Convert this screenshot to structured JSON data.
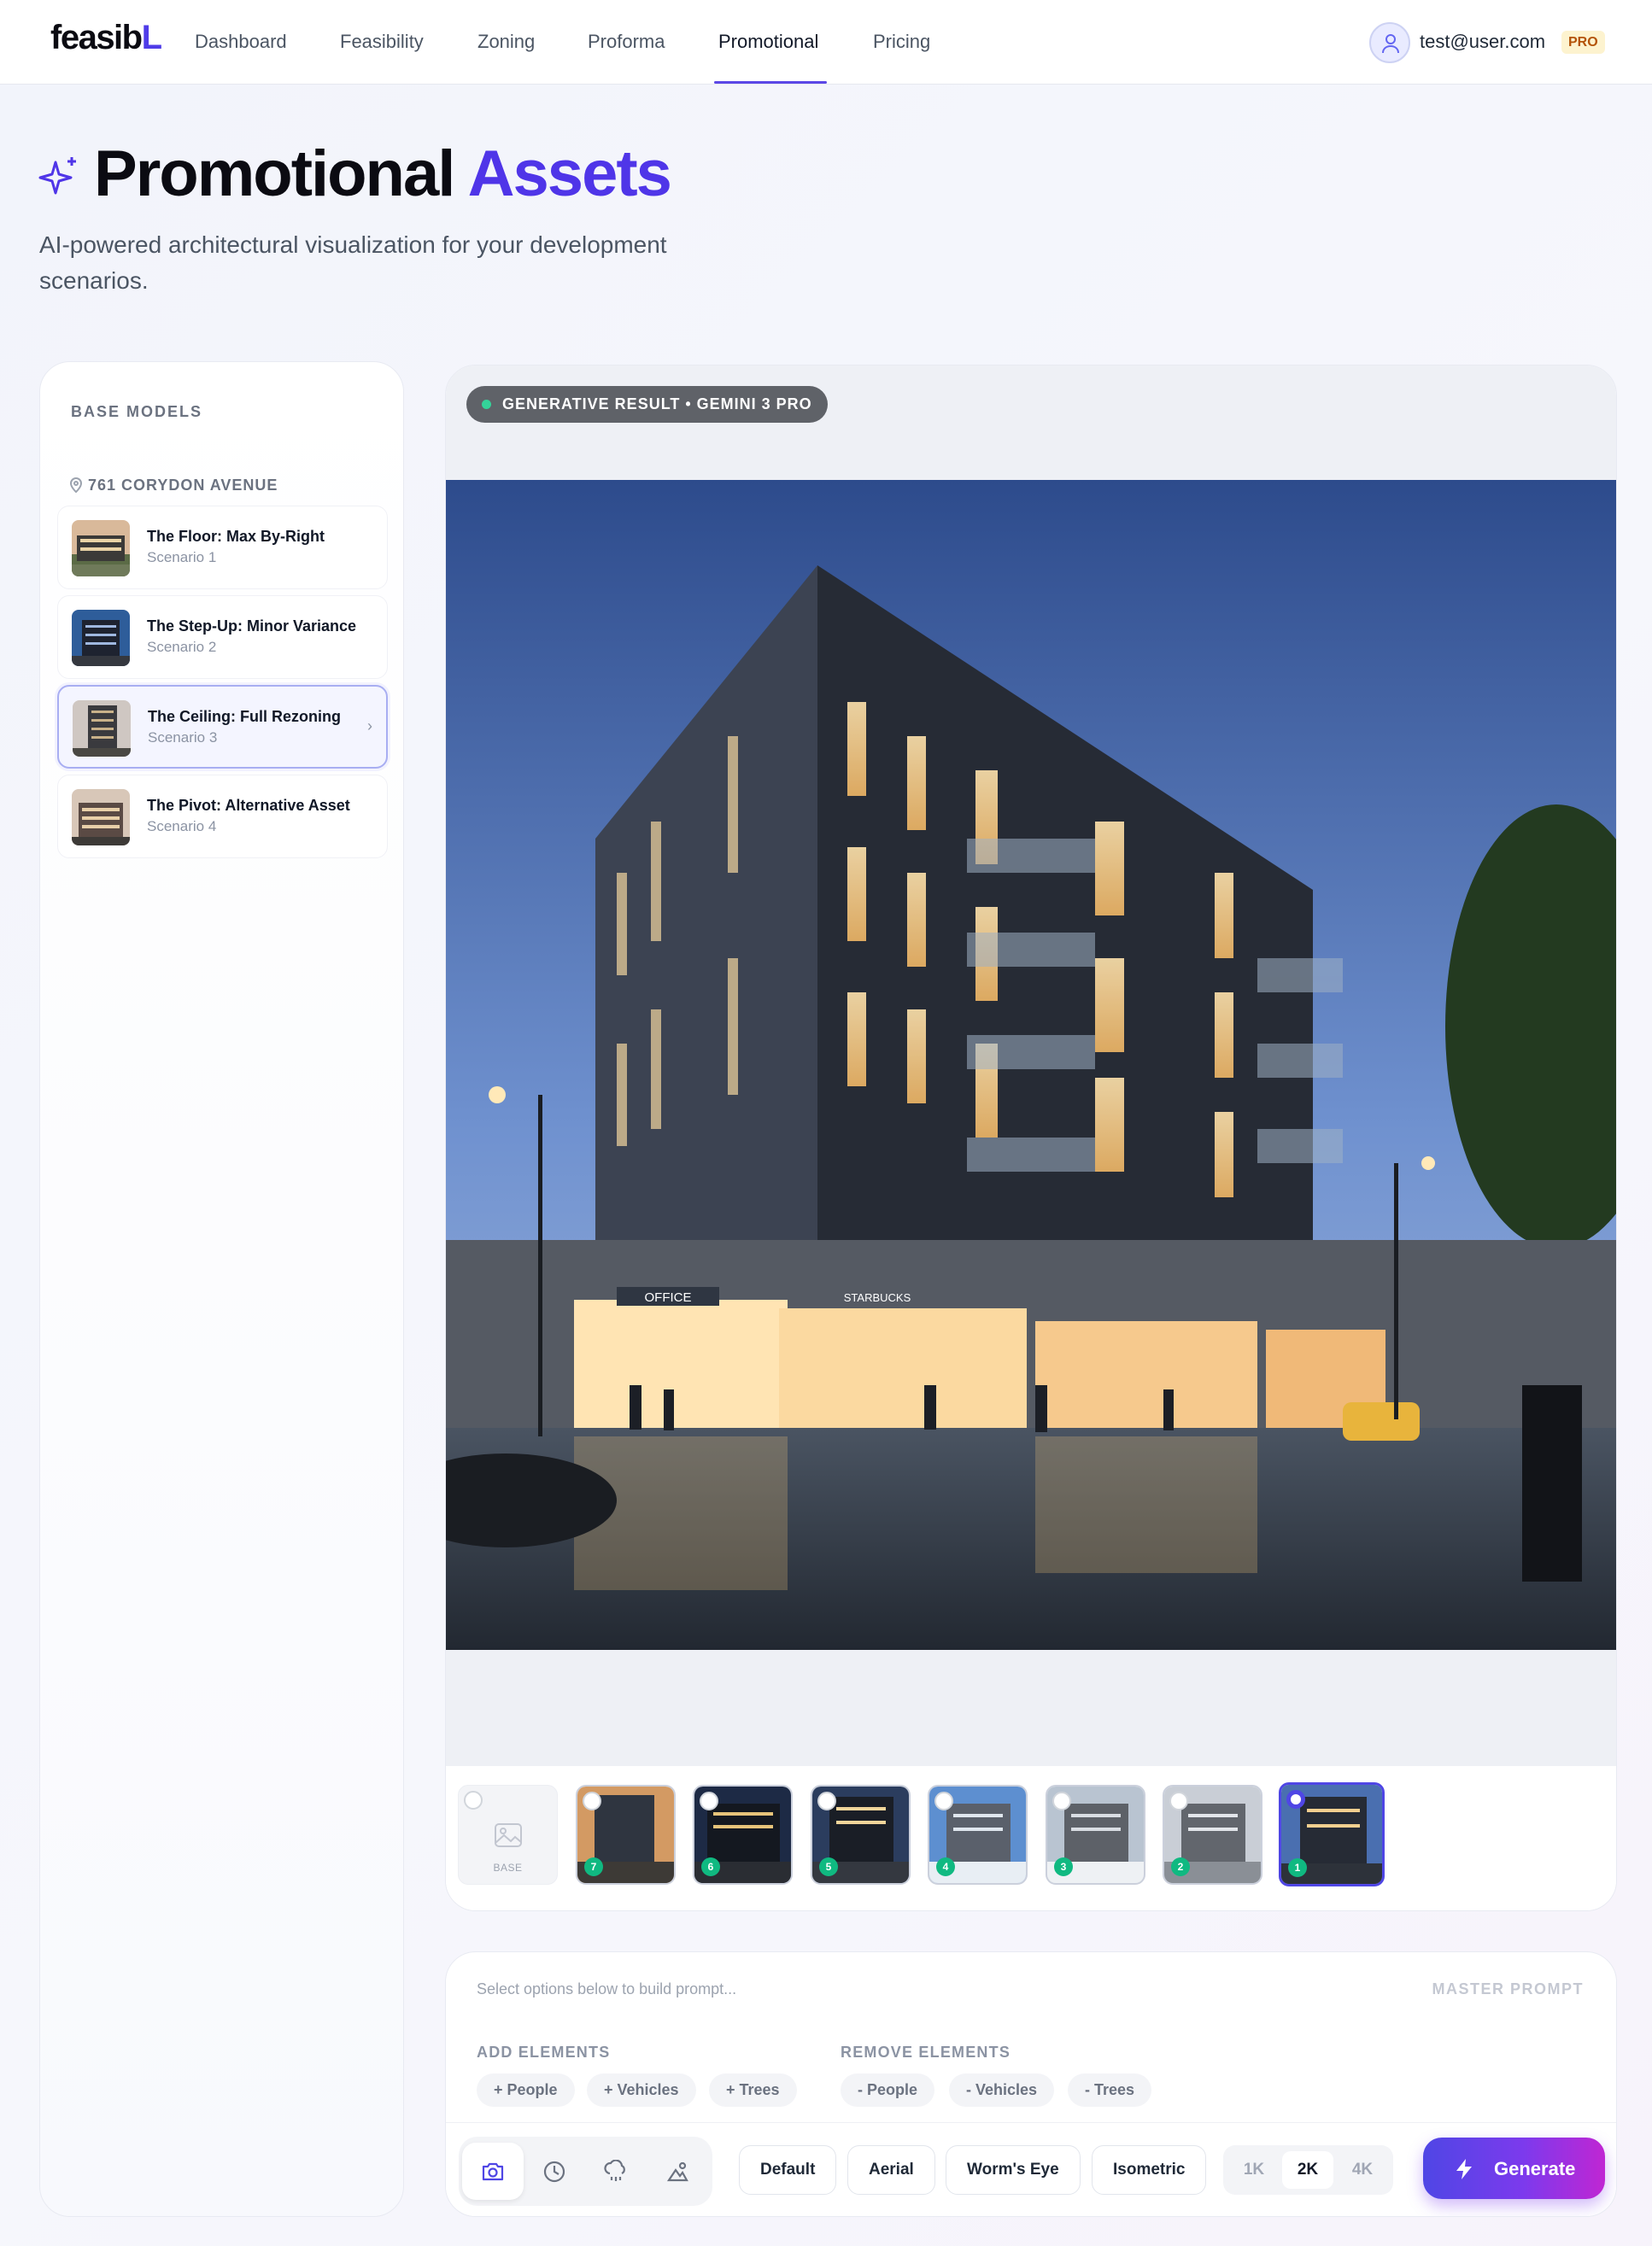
{
  "nav": {
    "logo_main": "feasib",
    "logo_accent": "L",
    "links": [
      "Dashboard",
      "Feasibility",
      "Zoning",
      "Proforma",
      "Promotional",
      "Pricing"
    ],
    "active": "Promotional",
    "user_email": "test@user.com",
    "plan_badge": "PRO"
  },
  "header": {
    "title_main": "Promotional",
    "title_accent": "Assets",
    "subtitle": "AI-powered architectural visualization for your development scenarios."
  },
  "sidebar": {
    "heading": "BASE MODELS",
    "location": "761 CORYDON AVENUE",
    "scenarios": [
      {
        "title": "The Floor: Max By-Right",
        "subtitle": "Scenario 1"
      },
      {
        "title": "The Step-Up: Minor Variance",
        "subtitle": "Scenario 2"
      },
      {
        "title": "The Ceiling: Full Rezoning",
        "subtitle": "Scenario 3",
        "active": true
      },
      {
        "title": "The Pivot: Alternative Asset",
        "subtitle": "Scenario 4"
      }
    ],
    "chevron": "›"
  },
  "viewer": {
    "badge": "GENERATIVE RESULT • GEMINI 3 PRO",
    "base_label": "BASE",
    "thumbnails": [
      "7",
      "6",
      "5",
      "4",
      "3",
      "2",
      "1"
    ],
    "selected_thumbnail": "1"
  },
  "prompt": {
    "placeholder": "Select options below to build prompt...",
    "master_label": "MASTER PROMPT",
    "add_title": "ADD ELEMENTS",
    "add_chips": [
      "+ People",
      "+ Vehicles",
      "+ Trees"
    ],
    "remove_title": "REMOVE ELEMENTS",
    "remove_chips": [
      "- People",
      "- Vehicles",
      "- Trees"
    ],
    "tool_icons": [
      "camera-icon",
      "clock-icon",
      "weather-icon",
      "nature-icon"
    ],
    "views": [
      "Default",
      "Aerial",
      "Worm's Eye",
      "Isometric"
    ],
    "resolutions": [
      "1K",
      "2K",
      "4K"
    ],
    "active_resolution": "2K",
    "generate_label": "Generate"
  },
  "colors": {
    "accent": "#4f35e8",
    "badge_green": "#10b981",
    "generate_gradient": [
      "#4f46e5",
      "#7c3aed",
      "#c026d3"
    ]
  }
}
